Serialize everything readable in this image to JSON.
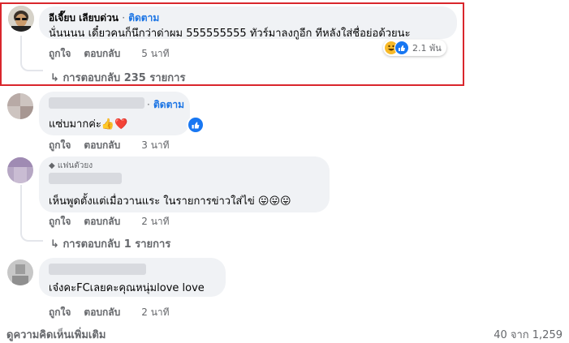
{
  "comments": [
    {
      "name": "อีเจี๊ยบ เลียบด่วน",
      "separator": "·",
      "follow": "ติดตาม",
      "text": "นั่นนนน เดี๋ยวคนก็นึกว่าด่าผม 555555555 ทัวร์มาลงกูอีก ทีหลังใส่ชื่อย่อด้วยนะ",
      "like": "ถูกใจ",
      "reply": "ตอบกลับ",
      "time": "5 นาที",
      "reaction_count": "2.1 พัน",
      "replies": "การตอบกลับ 235 รายการ"
    },
    {
      "separator": "·",
      "follow": "ติดตาม",
      "text": "แซ่บมากค่ะ👍❤️",
      "like": "ถูกใจ",
      "reply": "ตอบกลับ",
      "time": "3 นาที"
    },
    {
      "badge": "แฟนตัวยง",
      "text": "เห็นพูดตั้งแต่เมื่อวานแระ ในรายการข่าวใส่ไข่ 😛😛😛",
      "like": "ถูกใจ",
      "reply": "ตอบกลับ",
      "time": "2 นาที",
      "replies": "การตอบกลับ 1 รายการ"
    },
    {
      "text": "เจ๋งคะFCเลยคะคุณหนุ่มlove love",
      "like": "ถูกใจ",
      "reply": "ตอบกลับ",
      "time": "2 นาที"
    }
  ],
  "footer": {
    "more": "ดูความคิดเห็นเพิ่มเติม",
    "count": "40 จาก 1,259"
  },
  "colors": {
    "highlight": "#d9262c",
    "bubble": "#f0f2f5",
    "link": "#1b74e4",
    "muted": "#65676b"
  }
}
